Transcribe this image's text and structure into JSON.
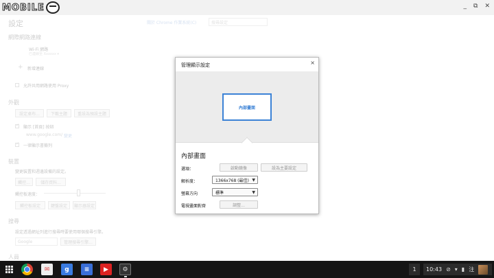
{
  "logo": {
    "text": "MOBILE"
  },
  "window": {
    "minimize": "_",
    "restore": "⧉",
    "close": "✕"
  },
  "settings": {
    "title": "設定",
    "about_link": "關於 Chrome 作業系統(C)",
    "search_placeholder": "搜尋設定",
    "network": {
      "heading": "網際網路連線",
      "wifi": "Wi-Fi 網路",
      "wifi_status": "已連線至 Xxxxxx ▾",
      "add": "新增連線",
      "proxy": "允許共用網路使用 Proxy"
    },
    "appearance": {
      "heading": "外觀",
      "btn_wallpaper": "設定桌布...",
      "btn_theme": "下載主題",
      "btn_reset": "重設為預設主題",
      "show_home": "顯示 [首頁] 按鈕",
      "home_url": "www.google.com/",
      "home_change": "變更",
      "bookmarks": "一律顯示書籤列"
    },
    "device": {
      "heading": "裝置",
      "desc": "變更裝置和週邊設備的設定。",
      "btn_touchpad": "觸控...",
      "btn_storage": "儲存資料...",
      "speed": "觸控板速度：",
      "btn_display": "觸控板設定",
      "btn_keyboard": "鍵盤設定",
      "btn_screen": "顯示器設定"
    },
    "search": {
      "heading": "搜尋",
      "desc": "設定透過網址列進行搜尋時要使用哪個搜尋引擎。",
      "engine": "Google",
      "btn_manage": "管理搜尋引擎..."
    },
    "people": {
      "heading": "人員"
    }
  },
  "dialog": {
    "title": "管理顯示設定",
    "close": "×",
    "display_name": "內部畫面",
    "heading": "內部畫面",
    "options_label": "選項：",
    "btn_mirror": "啟動鏡像",
    "btn_primary": "設為主要設定",
    "resolution_label": "解析度：",
    "resolution_value": "1366x768 (最佳)",
    "orientation_label": "螢幕方向",
    "orientation_value": "標準",
    "overscan_label": "電視畫面對齊",
    "btn_adjust": "調整..."
  },
  "shelf": {
    "gplus": "g",
    "docs": "≡",
    "youtube": "▶",
    "settings": "⚙",
    "badge": "1",
    "time": "10:43",
    "ime": "注"
  },
  "colors": {
    "accent": "#3b82d6",
    "shelf": "#151515"
  }
}
